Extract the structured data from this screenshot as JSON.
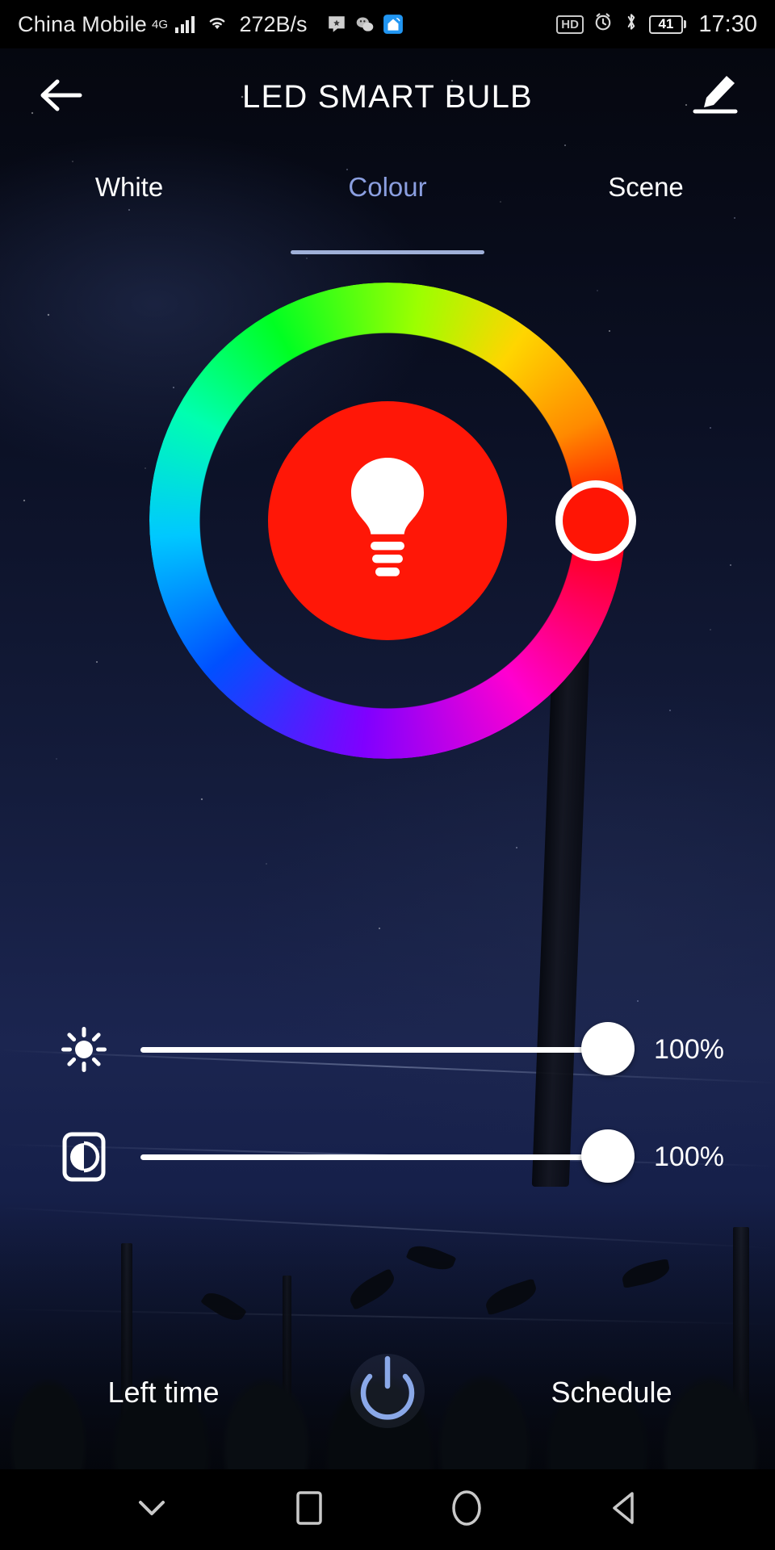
{
  "status_bar": {
    "carrier": "China Mobile",
    "network_type": "4G",
    "signal_icon": "signal-bars-icon",
    "wifi_icon": "wifi-icon",
    "net_speed": "272B/s",
    "app_icons": [
      "bluetooth-share-icon",
      "wechat-icon",
      "smart-home-icon"
    ],
    "hd_badge": "HD",
    "alarm_icon": "alarm-clock-icon",
    "bluetooth_icon": "bluetooth-icon",
    "battery_level": "41",
    "clock": "17:30"
  },
  "header": {
    "back_icon": "arrow-left-icon",
    "title": "LED SMART BULB",
    "edit_icon": "pencil-edit-icon"
  },
  "tabs": [
    {
      "label": "White",
      "active": false
    },
    {
      "label": "Colour",
      "active": true
    },
    {
      "label": "Scene",
      "active": false
    }
  ],
  "color_wheel": {
    "bulb_icon": "light-bulb-icon",
    "selected_color": "#ff1505",
    "inner_disc_color": "#ff1707",
    "handle_position_deg": 0,
    "handle_ring_color": "#ffffff"
  },
  "sliders": [
    {
      "name": "brightness",
      "icon": "brightness-sun-icon",
      "value": 100,
      "value_label": "100%"
    },
    {
      "name": "saturation",
      "icon": "contrast-icon",
      "value": 100,
      "value_label": "100%"
    }
  ],
  "bottom_bar": {
    "left_label": "Left time",
    "power_icon": "power-button-icon",
    "power_color": "#8aa8e8",
    "right_label": "Schedule"
  },
  "nav_bar": {
    "hide_icon": "chevron-down-icon",
    "recents_icon": "square-recents-icon",
    "home_icon": "circle-home-icon",
    "back_icon": "triangle-back-icon"
  },
  "theme": {
    "accent": "#8b9fe0",
    "underline": "#9fb0d8",
    "text": "#ffffff",
    "status_bg": "#000000"
  }
}
